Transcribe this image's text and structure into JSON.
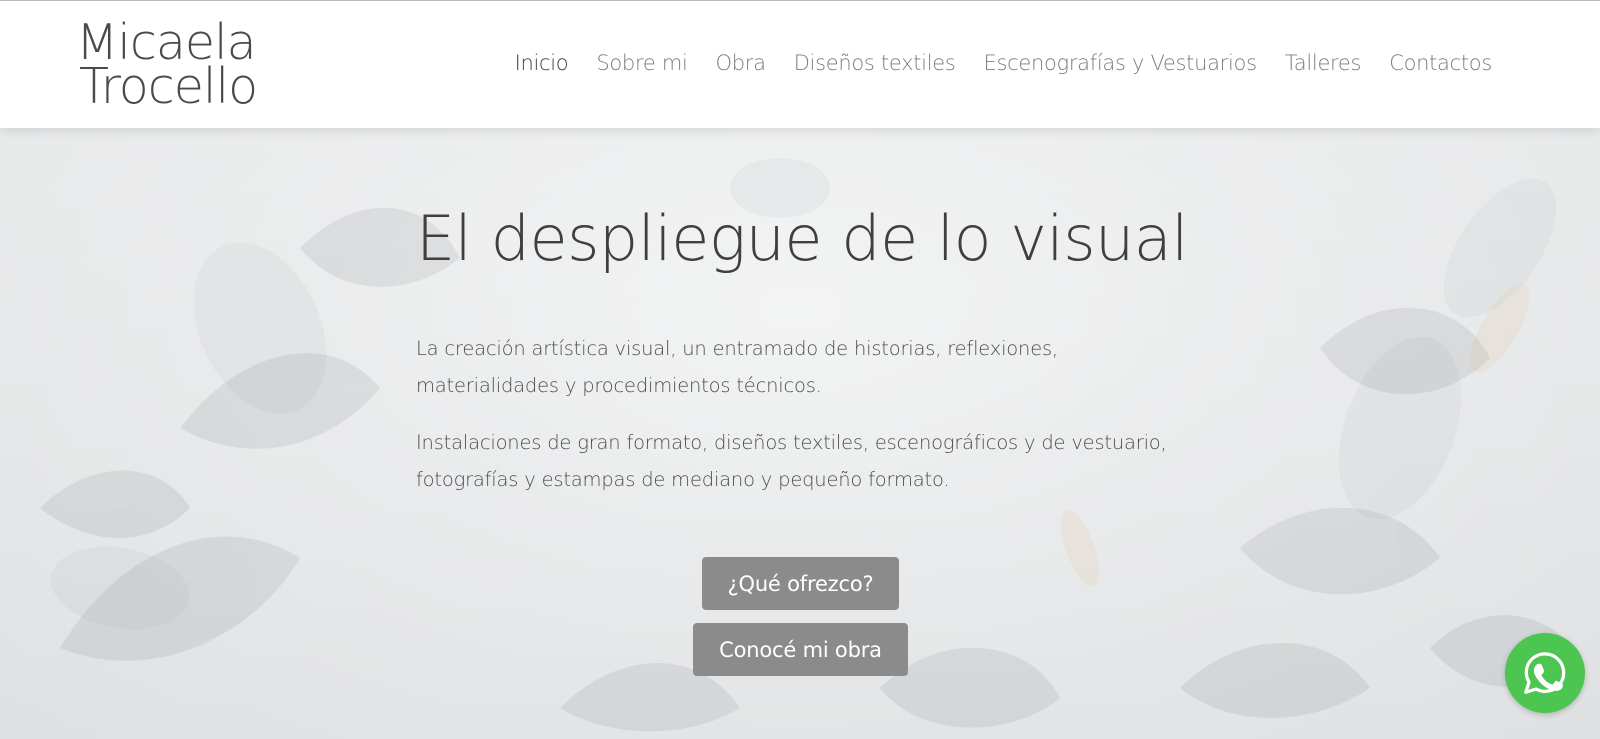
{
  "site": {
    "logo_line1": "Micaela",
    "logo_line2": "Trocello"
  },
  "nav": {
    "items": [
      {
        "label": "Inicio",
        "active": true
      },
      {
        "label": "Sobre mi",
        "active": false
      },
      {
        "label": "Obra",
        "active": false
      },
      {
        "label": "Diseños textiles",
        "active": false
      },
      {
        "label": "Escenografías y Vestuarios",
        "active": false
      },
      {
        "label": "Talleres",
        "active": false
      },
      {
        "label": "Contactos",
        "active": false
      }
    ]
  },
  "hero": {
    "title": "El despliegue de lo visual",
    "paragraph1": "La creación artística visual, un entramado de historias, reflexiones, materialidades y procedimientos técnicos.",
    "paragraph2": "Instalaciones de gran formato, diseños textiles, escenográficos y de vestuario, fotografías y estampas de mediano y pequeño formato.",
    "button1": "¿Qué ofrezco?",
    "button2": "Conocé mi obra"
  },
  "whatsapp": {
    "icon": "whatsapp-icon"
  },
  "colors": {
    "button_bg": "#8b8b8b",
    "whatsapp_green": "#4cc650",
    "text_dark": "#3f3f3f",
    "nav_text": "#7c7c7c"
  }
}
